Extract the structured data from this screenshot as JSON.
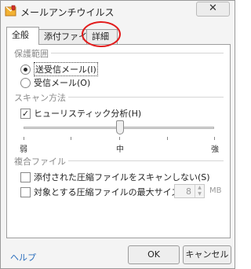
{
  "window": {
    "title": "メールアンチウイルス",
    "close_glyph": "✕",
    "icon": "shield-app-icon"
  },
  "tabs": [
    {
      "label": "全般",
      "active": true
    },
    {
      "label": "添付ファイル",
      "active": false
    },
    {
      "label": "詳細",
      "active": false
    }
  ],
  "protection_scope": {
    "title": "保護範囲",
    "options": [
      {
        "label": "送受信メール(I)",
        "selected": true
      },
      {
        "label": "受信メール(O)",
        "selected": false
      }
    ]
  },
  "scan_method": {
    "title": "スキャン方法",
    "heuristic_label": "ヒューリスティック分析(H)",
    "heuristic_checked": true,
    "checkmark": "✓",
    "level_labels": [
      "弱",
      "中",
      "強"
    ],
    "level": "中",
    "level_fraction": 0.5
  },
  "compressed_files": {
    "title": "複合ファイル",
    "skip_archives_label": "添付された圧縮ファイルをスキャンしない(S)",
    "skip_archives_checked": false,
    "max_size_label": "対象とする圧縮ファイルの最大サイズ(D)：",
    "max_size_checked": false,
    "max_size_value": "8",
    "max_size_unit": "MB"
  },
  "footer": {
    "help_label": "ヘルプ",
    "ok_label": "OK",
    "cancel_label": "キャンセル"
  },
  "colors": {
    "highlight_circle": "#e21c1c",
    "link": "#2a6ebd"
  }
}
